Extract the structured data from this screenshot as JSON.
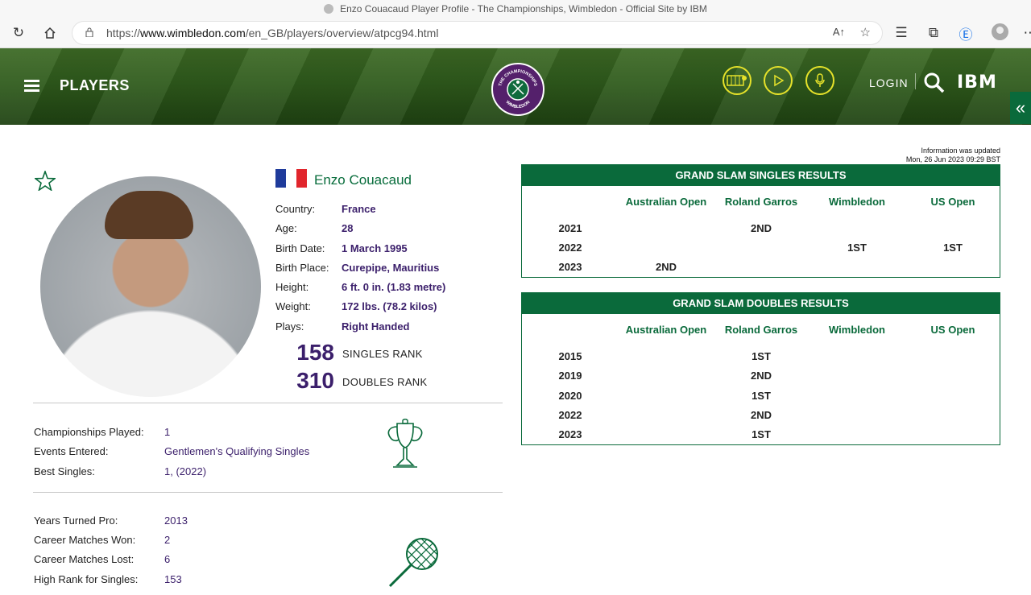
{
  "browser": {
    "window_title": "Enzo Couacaud Player Profile - The Championships, Wimbledon - Official Site by IBM",
    "url_prefix": "https://",
    "url_host": "www.wimbledon.com",
    "url_path": "/en_GB/players/overview/atpcg94.html"
  },
  "header": {
    "section_title": "PLAYERS",
    "login_label": "LOGIN",
    "brand": "IBM",
    "logo_text_top": "THE CHAMPIONSHIPS",
    "logo_text_bottom": "WIMBLEDON"
  },
  "player": {
    "name": "Enzo Couacaud",
    "flag_colors": [
      "#1f3b9b",
      "#ffffff",
      "#e1252c"
    ],
    "details": [
      {
        "label": "Country:",
        "value": "France"
      },
      {
        "label": "Age:",
        "value": "28"
      },
      {
        "label": "Birth Date:",
        "value": "1 March 1995"
      },
      {
        "label": "Birth Place:",
        "value": "Curepipe, Mauritius"
      },
      {
        "label": "Height:",
        "value": "6 ft. 0 in. (1.83 metre)"
      },
      {
        "label": "Weight:",
        "value": "172 lbs. (78.2 kilos)"
      },
      {
        "label": "Plays:",
        "value": "Right Handed"
      }
    ],
    "singles_rank": "158",
    "singles_rank_label": "SINGLES RANK",
    "doubles_rank": "310",
    "doubles_rank_label": "DOUBLES RANK"
  },
  "championships": [
    {
      "label": "Championships Played:",
      "value": "1"
    },
    {
      "label": "Events Entered:",
      "value": "Gentlemen's Qualifying Singles"
    },
    {
      "label": "Best Singles:",
      "value": "1, (2022)"
    }
  ],
  "career": [
    {
      "label": "Years Turned Pro:",
      "value": "2013"
    },
    {
      "label": "Career Matches Won:",
      "value": "2"
    },
    {
      "label": "Career Matches Lost:",
      "value": "6"
    },
    {
      "label": "High Rank for Singles:",
      "value": "153"
    }
  ],
  "update_note": {
    "line1": "Information was updated",
    "line2": "Mon, 26 Jun 2023 09:29 BST"
  },
  "results": {
    "columns": [
      "Australian Open",
      "Roland Garros",
      "Wimbledon",
      "US Open"
    ],
    "singles": {
      "title": "GRAND SLAM SINGLES RESULTS",
      "rows": [
        {
          "year": "2021",
          "cells": [
            "",
            "2ND",
            "",
            ""
          ]
        },
        {
          "year": "2022",
          "cells": [
            "",
            "",
            "1ST",
            "1ST"
          ]
        },
        {
          "year": "2023",
          "cells": [
            "2ND",
            "",
            "",
            ""
          ]
        }
      ]
    },
    "doubles": {
      "title": "GRAND SLAM DOUBLES RESULTS",
      "rows": [
        {
          "year": "2015",
          "cells": [
            "",
            "1ST",
            "",
            ""
          ]
        },
        {
          "year": "2019",
          "cells": [
            "",
            "2ND",
            "",
            ""
          ]
        },
        {
          "year": "2020",
          "cells": [
            "",
            "1ST",
            "",
            ""
          ]
        },
        {
          "year": "2022",
          "cells": [
            "",
            "2ND",
            "",
            ""
          ]
        },
        {
          "year": "2023",
          "cells": [
            "",
            "1ST",
            "",
            ""
          ]
        }
      ]
    }
  }
}
